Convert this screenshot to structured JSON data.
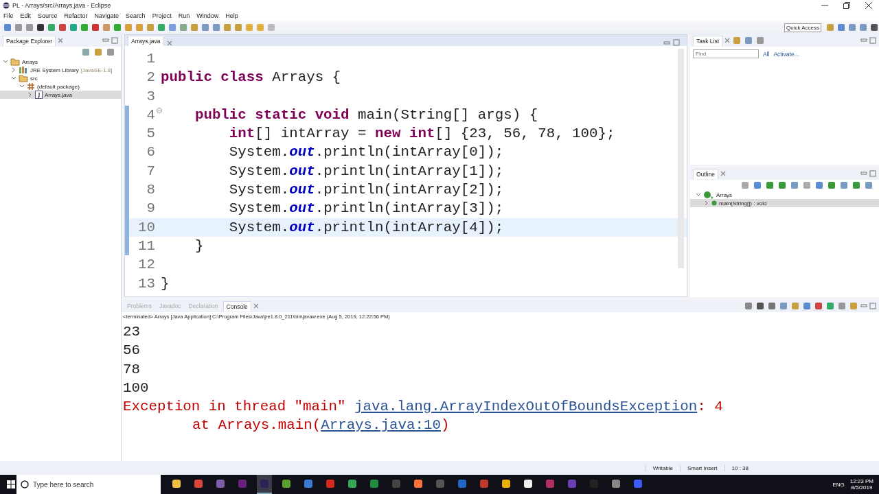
{
  "window": {
    "title": "PL - Arrays/src/Arrays.java - Eclipse"
  },
  "menu": [
    "File",
    "Edit",
    "Source",
    "Refactor",
    "Navigate",
    "Search",
    "Project",
    "Run",
    "Window",
    "Help"
  ],
  "toolbar": {
    "quick_access": "Quick Access"
  },
  "package_explorer": {
    "title": "Package Explorer",
    "tree": [
      {
        "label": "Arrays",
        "kind": "project",
        "expanded": true,
        "selected": false,
        "children": [
          {
            "label": "JRE System Library",
            "suffix": "[JavaSE-1.8]",
            "kind": "library",
            "expanded": false,
            "selected": false
          },
          {
            "label": "src",
            "kind": "folder",
            "expanded": true,
            "selected": false,
            "children": [
              {
                "label": "(default package)",
                "kind": "package",
                "expanded": true,
                "selected": false,
                "children": [
                  {
                    "label": "Arrays.java",
                    "kind": "java",
                    "expanded": false,
                    "selected": true
                  }
                ]
              }
            ]
          }
        ]
      }
    ]
  },
  "editor": {
    "tab": "Arrays.java",
    "lines": [
      {
        "number": "1",
        "current": false,
        "changed": false,
        "fold": false
      },
      {
        "number": "2",
        "current": false,
        "changed": false,
        "fold": false,
        "segments": [
          {
            "kind": "keyword",
            "text": "public class"
          },
          {
            "kind": "plain",
            "text": " Arrays {"
          }
        ]
      },
      {
        "number": "3",
        "current": false,
        "changed": false,
        "fold": false
      },
      {
        "number": "4",
        "current": false,
        "changed": true,
        "fold": true,
        "segments": [
          {
            "kind": "keyword",
            "text": "    public static void"
          },
          {
            "kind": "plain",
            "text": " main(String[] args) {"
          }
        ]
      },
      {
        "number": "5",
        "current": false,
        "changed": true,
        "fold": false,
        "segments": [
          {
            "kind": "keyword",
            "text": "        int"
          },
          {
            "kind": "plain",
            "text": "[] intArray = "
          },
          {
            "kind": "keyword",
            "text": "new int"
          },
          {
            "kind": "plain",
            "text": "[] {23, 56, 78, 100};"
          }
        ]
      },
      {
        "number": "6",
        "current": false,
        "changed": true,
        "fold": false,
        "segments": [
          {
            "kind": "plain",
            "text": "        System."
          },
          {
            "kind": "field",
            "text": "out"
          },
          {
            "kind": "plain",
            "text": ".println(intArray[0]);"
          }
        ]
      },
      {
        "number": "7",
        "current": false,
        "changed": true,
        "fold": false,
        "segments": [
          {
            "kind": "plain",
            "text": "        System."
          },
          {
            "kind": "field",
            "text": "out"
          },
          {
            "kind": "plain",
            "text": ".println(intArray[1]);"
          }
        ]
      },
      {
        "number": "8",
        "current": false,
        "changed": true,
        "fold": false,
        "segments": [
          {
            "kind": "plain",
            "text": "        System."
          },
          {
            "kind": "field",
            "text": "out"
          },
          {
            "kind": "plain",
            "text": ".println(intArray[2]);"
          }
        ]
      },
      {
        "number": "9",
        "current": false,
        "changed": true,
        "fold": false,
        "segments": [
          {
            "kind": "plain",
            "text": "        System."
          },
          {
            "kind": "field",
            "text": "out"
          },
          {
            "kind": "plain",
            "text": ".println(intArray[3]);"
          }
        ]
      },
      {
        "number": "10",
        "current": true,
        "changed": true,
        "fold": false,
        "segments": [
          {
            "kind": "plain",
            "text": "        System."
          },
          {
            "kind": "field",
            "text": "out"
          },
          {
            "kind": "plain",
            "text": ".println(intArray[4]);"
          }
        ]
      },
      {
        "number": "11",
        "current": false,
        "changed": true,
        "fold": false,
        "segments": [
          {
            "kind": "plain",
            "text": "    }"
          }
        ]
      },
      {
        "number": "12",
        "current": false,
        "changed": false,
        "fold": false
      },
      {
        "number": "13",
        "current": false,
        "changed": false,
        "fold": false,
        "segments": [
          {
            "kind": "plain",
            "text": "}"
          }
        ]
      }
    ]
  },
  "task_list": {
    "title": "Task List",
    "find_placeholder": "Find",
    "links": [
      "All",
      "Activate..."
    ]
  },
  "outline": {
    "title": "Outline",
    "tree": [
      {
        "label": "Arrays",
        "kind": "class",
        "expanded": true,
        "selected": false,
        "children": [
          {
            "label": "main(String[]) : void",
            "kind": "method",
            "expanded": false,
            "selected": true
          }
        ]
      }
    ]
  },
  "console": {
    "tabs": [
      {
        "label": "Problems",
        "selected": false
      },
      {
        "label": "Javadoc",
        "selected": false
      },
      {
        "label": "Declaration",
        "selected": false
      },
      {
        "label": "Console",
        "selected": true
      }
    ],
    "info": "<terminated> Arrays [Java Application] C:\\Program Files\\Java\\jre1.8.0_211\\bin\\javaw.exe (Aug 5, 2019, 12:22:56 PM)",
    "lines": [
      {
        "indent": false,
        "segments": [
          {
            "kind": "out",
            "text": "23"
          }
        ]
      },
      {
        "indent": false,
        "segments": [
          {
            "kind": "out",
            "text": "56"
          }
        ]
      },
      {
        "indent": false,
        "segments": [
          {
            "kind": "out",
            "text": "78"
          }
        ]
      },
      {
        "indent": false,
        "segments": [
          {
            "kind": "out",
            "text": "100"
          }
        ]
      },
      {
        "indent": false,
        "segments": [
          {
            "kind": "err",
            "text": "Exception in thread \"main\" "
          },
          {
            "kind": "link",
            "text": "java.lang.ArrayIndexOutOfBoundsException"
          },
          {
            "kind": "err",
            "text": ": 4"
          }
        ]
      },
      {
        "indent": true,
        "segments": [
          {
            "kind": "err",
            "text": "at Arrays.main("
          },
          {
            "kind": "link",
            "text": "Arrays.java:10"
          },
          {
            "kind": "err",
            "text": ")"
          }
        ]
      }
    ]
  },
  "status_bar": [
    "Writable",
    "Smart Insert",
    "10 : 38"
  ],
  "taskbar": {
    "search_placeholder": "Type here to search",
    "apps": [
      {
        "color": "#f0c040",
        "active": false
      },
      {
        "color": "#db4437",
        "active": false
      },
      {
        "color": "#7b5ea7",
        "active": false
      },
      {
        "color": "#68217a",
        "active": false
      },
      {
        "color": "#2c2255",
        "active": true
      },
      {
        "color": "#5aa02c",
        "active": false
      },
      {
        "color": "#3a7bd5",
        "active": false
      },
      {
        "color": "#d42a1e",
        "active": false
      },
      {
        "color": "#34a853",
        "active": false
      },
      {
        "color": "#1e8e3e",
        "active": false
      },
      {
        "color": "#444444",
        "active": false
      },
      {
        "color": "#ff7139",
        "active": false
      },
      {
        "color": "#555555",
        "active": false
      },
      {
        "color": "#2166c9",
        "active": false
      },
      {
        "color": "#c0392b",
        "active": false
      },
      {
        "color": "#e8b100",
        "active": false
      },
      {
        "color": "#eeeeee",
        "active": false
      },
      {
        "color": "#b03060",
        "active": false
      },
      {
        "color": "#6a3fb5",
        "active": false
      },
      {
        "color": "#222222",
        "active": false
      },
      {
        "color": "#888888",
        "active": false
      },
      {
        "color": "#3d5afe",
        "active": false
      }
    ],
    "language": "ENG",
    "time": "12:23 PM",
    "date": "8/5/2019"
  }
}
